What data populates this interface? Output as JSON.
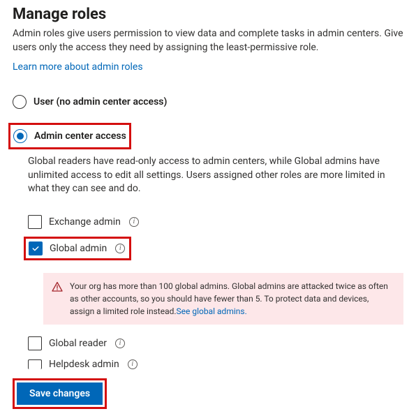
{
  "header": {
    "title": "Manage roles",
    "description": "Admin roles give users permission to view data and complete tasks in admin centers. Give users only the access they need by assigning the least-permissive role.",
    "learn_link": "Learn more about admin roles"
  },
  "radio": {
    "user": {
      "label": "User (no admin center access)"
    },
    "admin": {
      "label": "Admin center access",
      "description": "Global readers have read-only access to admin centers, while Global admins have unlimited access to edit all settings. Users assigned other roles are more limited in what they can see and do."
    }
  },
  "roles": {
    "exchange": {
      "label": "Exchange admin",
      "checked": false
    },
    "global_admin": {
      "label": "Global admin",
      "checked": true
    },
    "global_reader": {
      "label": "Global reader",
      "checked": false
    },
    "helpdesk": {
      "label": "Helpdesk admin",
      "checked": false
    }
  },
  "warning": {
    "text": "Your org has more than 100 global admins. Global admins are attacked twice as often as other accounts, so you should have fewer than 5. To protect data and devices, assign a limited role instead.",
    "link": "See global admins."
  },
  "actions": {
    "save": "Save changes"
  },
  "info_glyph": "i"
}
